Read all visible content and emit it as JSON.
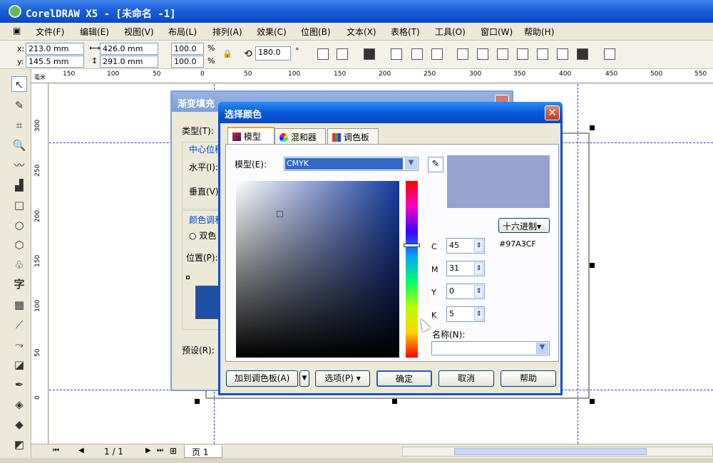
{
  "app": {
    "title": "CorelDRAW X5 - [未命名 -1]"
  },
  "menubar": {
    "items": [
      "文件(F)",
      "编辑(E)",
      "视图(V)",
      "布局(L)",
      "排列(A)",
      "效果(C)",
      "位图(B)",
      "文本(X)",
      "表格(T)",
      "工具(O)",
      "窗口(W)",
      "帮助(H)"
    ]
  },
  "propbar": {
    "x_label": "x:",
    "x_value": "213.0 mm",
    "y_label": "y:",
    "y_value": "145.5 mm",
    "width_value": "426.0 mm",
    "height_value": "291.0 mm",
    "scale_x": "100.0",
    "scale_y": "100.0",
    "percent": "%",
    "rotation": "180.0",
    "degree": "°"
  },
  "ruler_h": [
    "150",
    "100",
    "50",
    "0",
    "50",
    "100",
    "150",
    "200",
    "250",
    "300",
    "350",
    "400",
    "450",
    "500",
    "550"
  ],
  "ruler_v": [
    "300",
    "250",
    "200",
    "150",
    "100",
    "50",
    "0"
  ],
  "ruler_unit": "毫米",
  "statusbar": {
    "page_count": "1 / 1",
    "page_tab": "页 1"
  },
  "gradient_dialog": {
    "title": "渐变填充",
    "type_label": "类型(T):",
    "center_group": "中心位移",
    "horizontal_label": "水平(I):",
    "vertical_label": "垂直(V):",
    "blend_group": "颜色调和",
    "two_color": "双色",
    "position_label": "位置(P):",
    "presets_label": "预设(R):"
  },
  "color_dialog": {
    "title": "选择颜色",
    "tabs": [
      "模型",
      "混和器",
      "调色板"
    ],
    "model_label": "模型(E):",
    "model_value": "CMYK",
    "hex_button": "十六进制",
    "hex_value": "#97A3CF",
    "cmyk": {
      "c_label": "C",
      "c_value": "45",
      "m_label": "M",
      "m_value": "31",
      "y_label": "Y",
      "y_value": "0",
      "k_label": "K",
      "k_value": "5"
    },
    "name_label": "名称(N):",
    "name_value": "",
    "buttons": {
      "add_palette": "加到调色板(A)",
      "options": "选项(P)",
      "ok": "确定",
      "cancel": "取消",
      "help": "帮助"
    }
  },
  "colors": {
    "selected_color": "#97A3CF",
    "title_blue": "#0A5AD9",
    "guide_blue": "#2B3DBD"
  }
}
